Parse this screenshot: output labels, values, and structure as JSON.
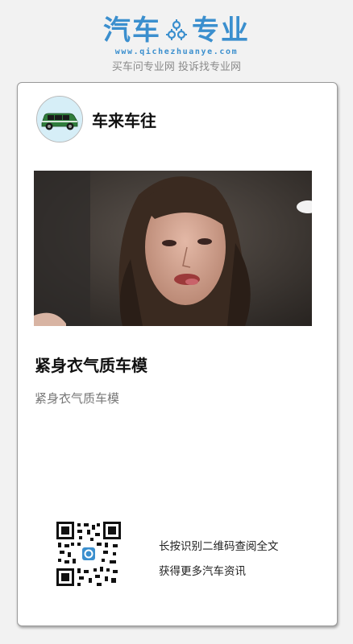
{
  "brand": {
    "name_left": "汽车",
    "name_right": "专业",
    "url": "www.qichezhuanye.com",
    "slogan": "买车问专业网 投诉找专业网",
    "color": "#3b8fce"
  },
  "account": {
    "name": "车来车往",
    "avatar_icon": "green-car-icon"
  },
  "article": {
    "title": "紧身衣气质车模",
    "summary": "紧身衣气质车模"
  },
  "footer": {
    "qr_icon": "qr-code-icon",
    "hint_line1": "长按识别二维码查阅全文",
    "hint_line2": "获得更多汽车资讯"
  }
}
